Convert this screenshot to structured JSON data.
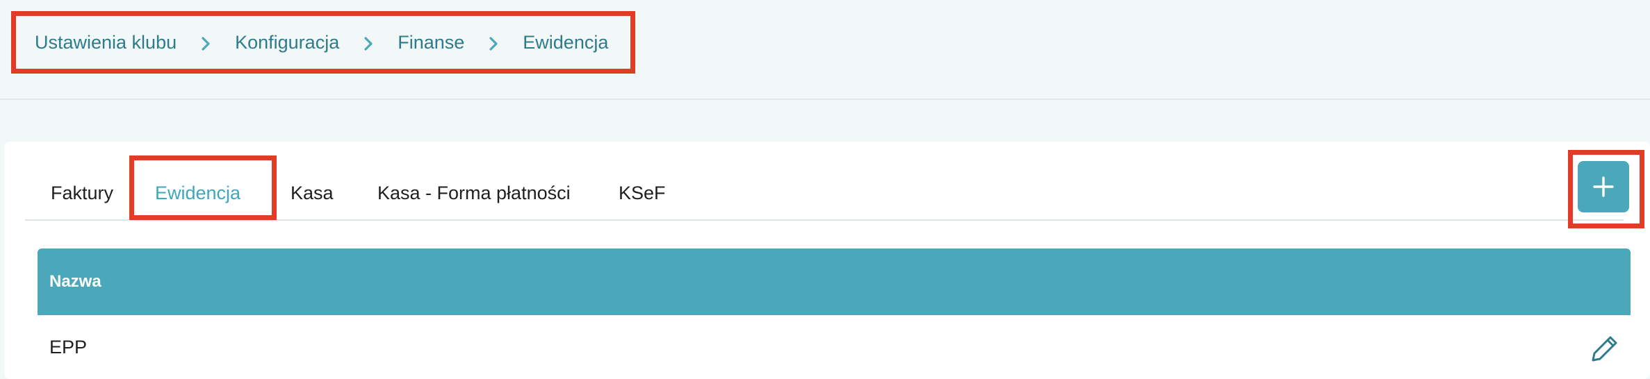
{
  "breadcrumb": {
    "items": [
      "Ustawienia klubu",
      "Konfiguracja",
      "Finanse",
      "Ewidencja"
    ],
    "separator_icon": "chevron-right-icon"
  },
  "tabs": [
    {
      "label": "Faktury",
      "active": false
    },
    {
      "label": "Ewidencja",
      "active": true
    },
    {
      "label": "Kasa",
      "active": false
    },
    {
      "label": "Kasa - Forma płatności",
      "active": false
    },
    {
      "label": "KSeF",
      "active": false
    }
  ],
  "add_button": {
    "icon": "plus-icon"
  },
  "table": {
    "columns": [
      "Nazwa"
    ],
    "rows": [
      {
        "name": "EPP",
        "action_icon": "pencil-icon"
      }
    ]
  },
  "colors": {
    "accent": "#4aa8ba",
    "link": "#2e7b8c",
    "highlight": "#e23c26",
    "background": "#f2f7f7"
  }
}
